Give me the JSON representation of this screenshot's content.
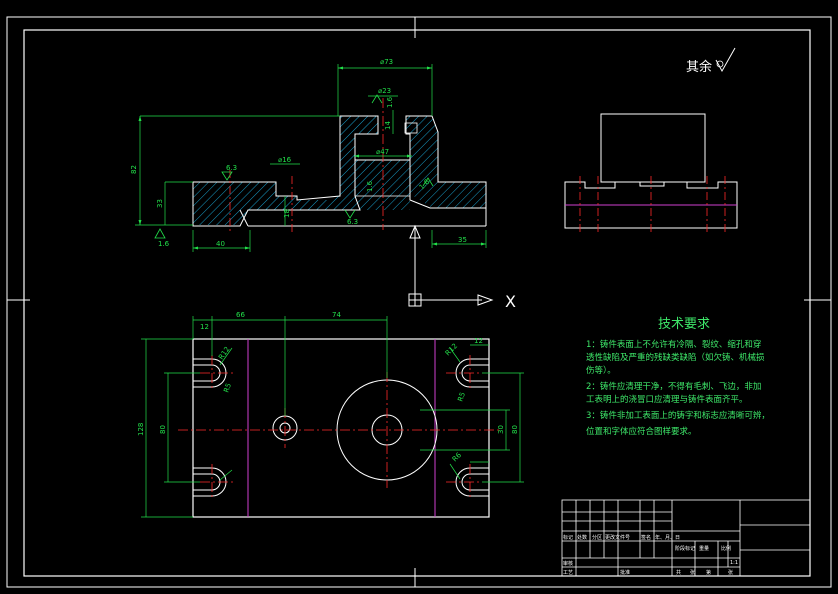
{
  "colors": {
    "background": "#000000",
    "outline": "#ffffff",
    "dimension": "#22e04a",
    "centerline": "#ff2a2a",
    "hatch": "#1ec8ff",
    "phantom": "#d040d0"
  },
  "roughness_note": "其余",
  "section_view": {
    "dims": {
      "d73": "⌀73",
      "d23": "⌀23",
      "d47": "⌀47",
      "d16": "⌀16",
      "h82": "82",
      "h33": "33",
      "w40": "40",
      "w35": "35",
      "h14": "14",
      "h18": "18",
      "r16a": "1.6",
      "r16b": "1.6",
      "r16c": "1.6",
      "r16d": "1.6",
      "r63a": "6.3",
      "r63b": "6.3"
    }
  },
  "axis": {
    "x_label": "X"
  },
  "plan_view": {
    "dims": {
      "w12a": "12",
      "w66": "66",
      "w74": "74",
      "w12b": "12",
      "h128": "128",
      "h80a": "80",
      "h30": "30",
      "h80b": "80",
      "r12a": "R12",
      "r12b": "R12",
      "r5a": "R5",
      "r5b": "R5",
      "r6": "R6"
    }
  },
  "tech_requirements": {
    "title": "技术要求",
    "lines": [
      "1：铸件表面上不允许有冷隔、裂纹、缩孔和穿",
      "透性缺陷及严重的残缺类缺陷（如欠铸、机械损",
      "伤等）。",
      "2：铸件应清理干净，不得有毛刺、飞边，非加",
      "工表明上的浇冒口应清理与铸件表面齐平。",
      "3：铸件非加工表面上的铸字和标志应清晰可辨，",
      "位置和字体应符合图样要求。"
    ]
  },
  "title_block": {
    "row1": [
      "标记",
      "处数",
      "分区",
      "更改文件号",
      "签名",
      "年、月、日"
    ],
    "row2": [
      "阶段标记",
      "重量",
      "比例"
    ],
    "scale": "1:1",
    "row3": [
      "审核"
    ],
    "row4": [
      "工艺",
      "批准"
    ],
    "row5": [
      "共",
      "张",
      "第",
      "张"
    ]
  }
}
